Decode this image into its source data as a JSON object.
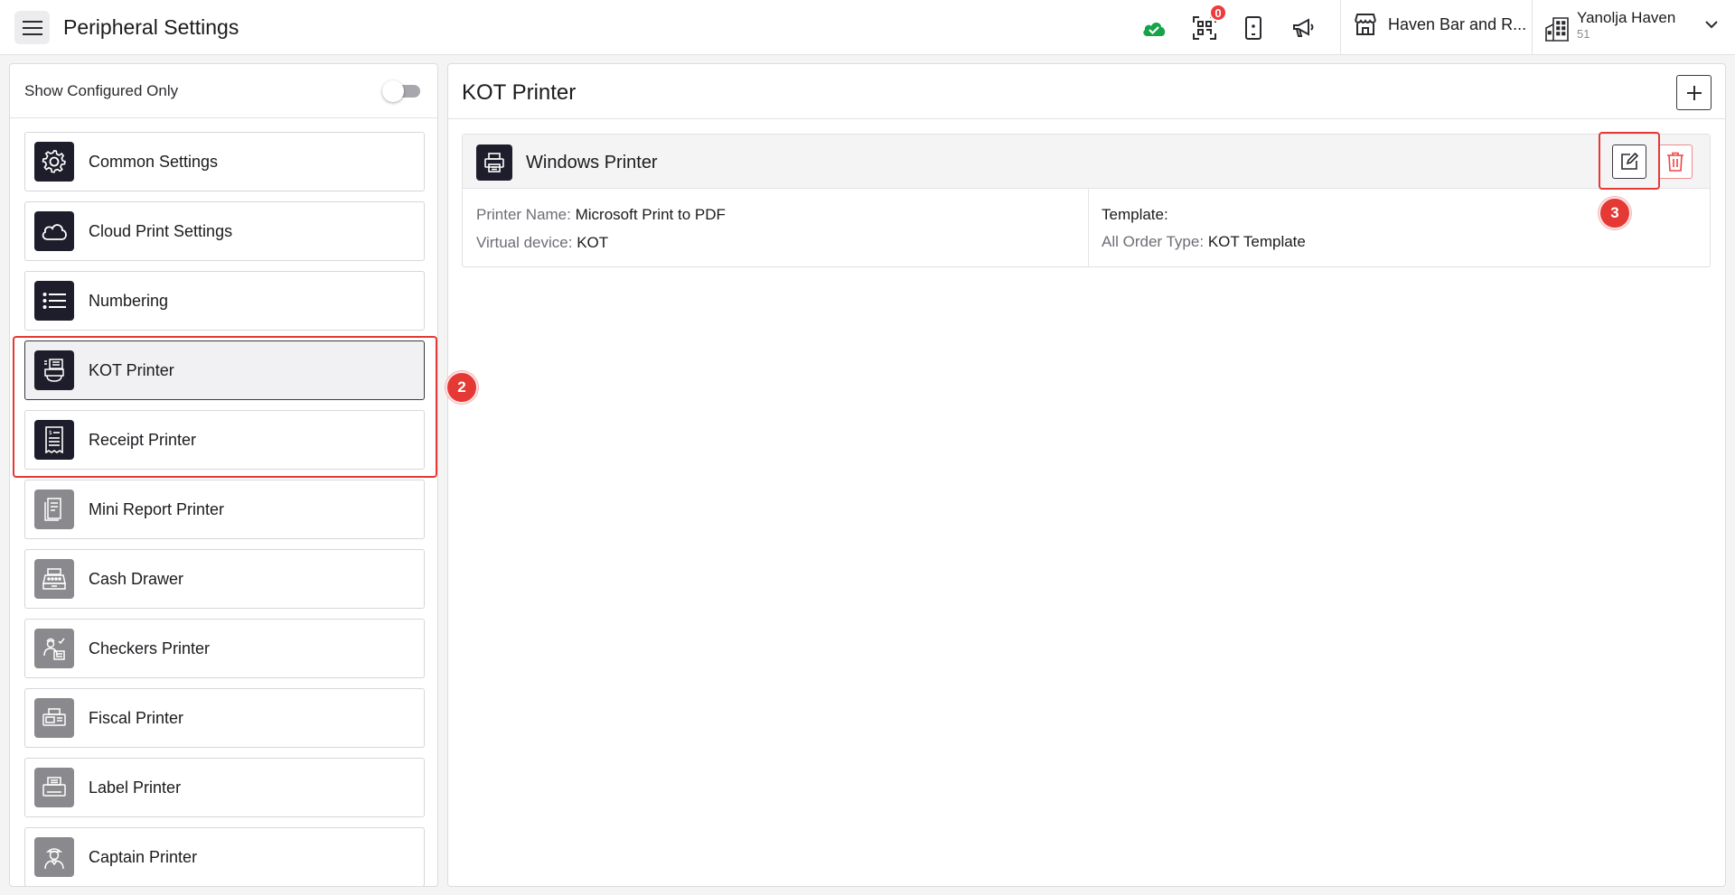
{
  "header": {
    "title": "Peripheral Settings",
    "notification_count": "0",
    "store_name": "Haven Bar and R...",
    "user_name": "Yanolja Haven",
    "user_sub": "51",
    "icons": [
      "menu-icon",
      "cloud-check-icon",
      "qr-code-icon",
      "tablet-icon",
      "megaphone-icon",
      "store-icon",
      "building-icon",
      "chevron-down-icon"
    ],
    "cloud_status_color": "#16a34a"
  },
  "sidebar": {
    "filter_label": "Show Configured Only",
    "filter_on": false,
    "items": [
      {
        "label": "Common Settings",
        "icon": "gear-icon",
        "configured": true
      },
      {
        "label": "Cloud Print Settings",
        "icon": "cloud-icon",
        "configured": true
      },
      {
        "label": "Numbering",
        "icon": "list-icon",
        "configured": true
      },
      {
        "label": "KOT Printer",
        "icon": "kot-printer-icon",
        "configured": true,
        "active": true
      },
      {
        "label": "Receipt Printer",
        "icon": "receipt-icon",
        "configured": true
      },
      {
        "label": "Mini Report Printer",
        "icon": "report-icon",
        "configured": false
      },
      {
        "label": "Cash Drawer",
        "icon": "cash-register-icon",
        "configured": false
      },
      {
        "label": "Checkers Printer",
        "icon": "checker-icon",
        "configured": false
      },
      {
        "label": "Fiscal Printer",
        "icon": "fiscal-printer-icon",
        "configured": false
      },
      {
        "label": "Label Printer",
        "icon": "label-printer-icon",
        "configured": false
      },
      {
        "label": "Captain Printer",
        "icon": "captain-icon",
        "configured": false
      }
    ]
  },
  "main": {
    "title": "KOT Printer",
    "card": {
      "title": "Windows Printer",
      "printer_name_label": "Printer Name:",
      "printer_name_value": "Microsoft Print to PDF",
      "virtual_device_label": "Virtual device:",
      "virtual_device_value": "KOT",
      "template_label": "Template:",
      "order_type_label": "All Order Type:",
      "order_type_value": "KOT Template"
    }
  },
  "annotations": {
    "step_2": "2",
    "step_3": "3",
    "color": "#e53935"
  }
}
